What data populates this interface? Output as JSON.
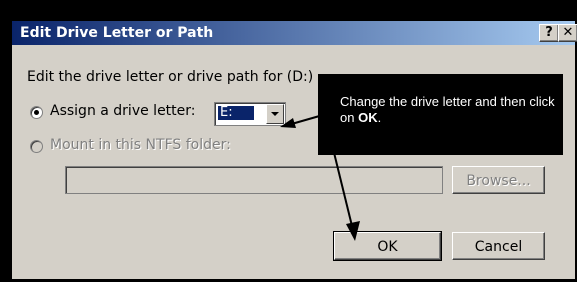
{
  "dialog": {
    "title": "Edit Drive Letter or Path",
    "help_button": "?",
    "close_button": "✕",
    "instruction": "Edit the drive letter or drive path for  (D:)",
    "assign_option": "Assign a drive letter:",
    "drive_letter": "E:",
    "mount_option": "Mount in this NTFS folder:",
    "mount_path": "",
    "browse_button": "Browse...",
    "ok_button": "OK",
    "cancel_button": "Cancel"
  },
  "callout": {
    "text_before": "Change the drive letter and then click on ",
    "text_bold": "OK",
    "text_after": "."
  },
  "colors": {
    "title_gradient_start": "#0a246a",
    "title_gradient_end": "#a6caf0",
    "dialog_face": "#d4d0c8",
    "callout_bg": "#000000"
  }
}
